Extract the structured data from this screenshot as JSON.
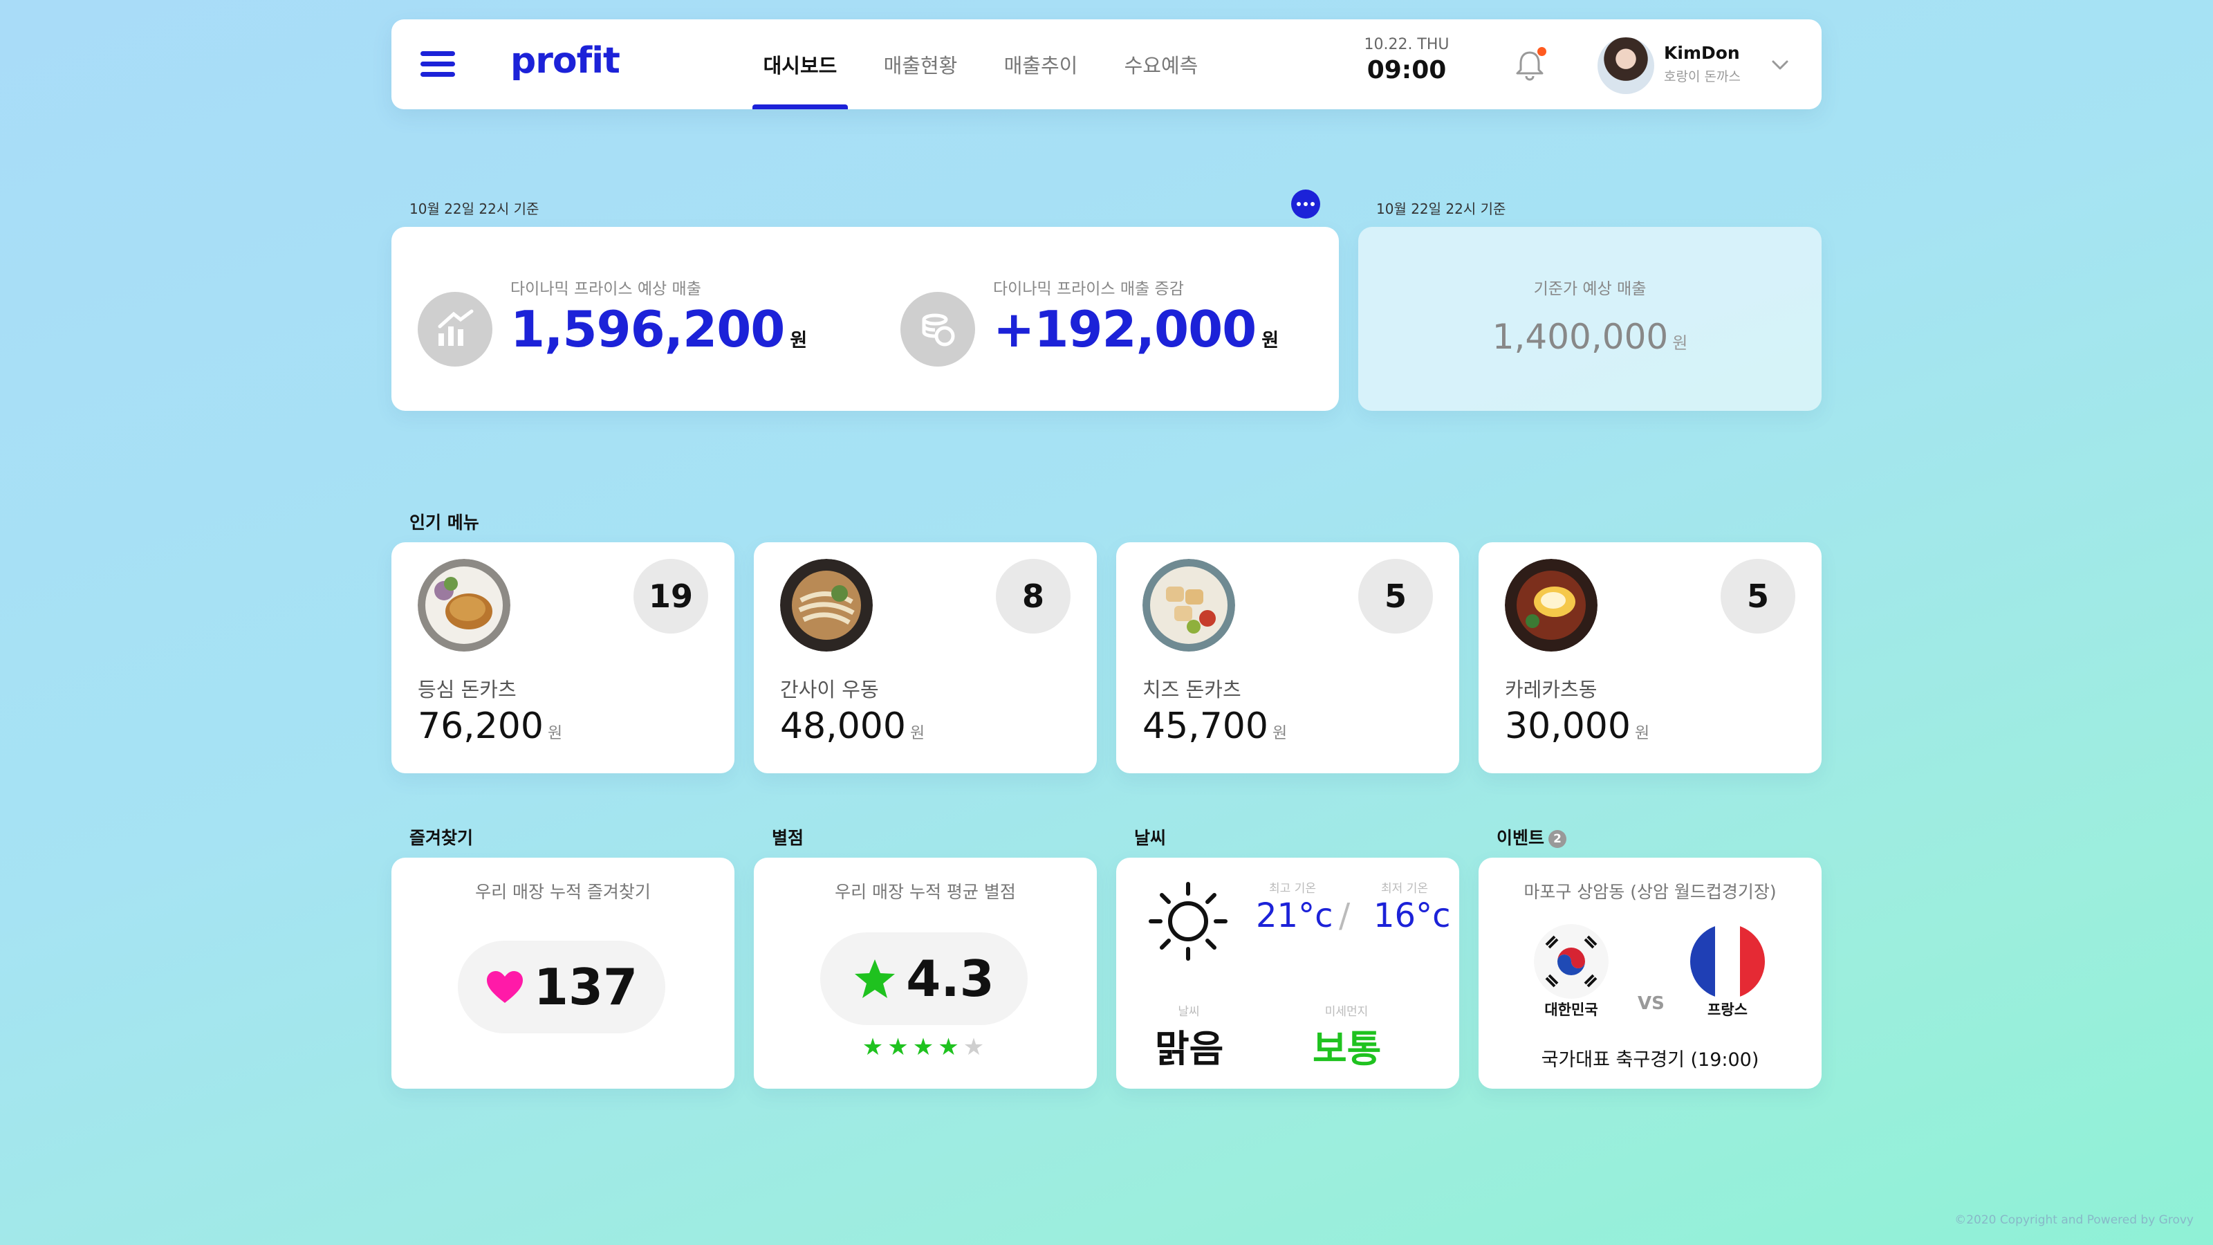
{
  "colors": {
    "accent": "#1c22d8",
    "heart": "#ff1aa8",
    "star": "#1fc21f",
    "good": "#1fc21f",
    "notify": "#ff5a1f"
  },
  "header": {
    "logo": "profit",
    "tabs": [
      {
        "label": "대시보드",
        "active": true
      },
      {
        "label": "매출현황",
        "active": false
      },
      {
        "label": "매출추이",
        "active": false
      },
      {
        "label": "수요예측",
        "active": false
      }
    ],
    "date": "10.22. THU",
    "time": "09:00",
    "user_name": "KimDon",
    "user_store": "호랑이 돈까스",
    "icons": {
      "menu": "hamburger-icon",
      "bell": "bell-icon",
      "dropdown": "chevron-down-icon"
    }
  },
  "sales": {
    "caption": "10월 22일 22시 기준",
    "dynamic_label": "다이나믹 프라이스 예상 매출",
    "dynamic_value": "1,596,200",
    "increase_label": "다이나믹 프라이스 매출 증감",
    "increase_value": "+192,000",
    "unit": "원"
  },
  "base": {
    "caption": "10월 22일 22시 기준",
    "label": "기준가 예상 매출",
    "value": "1,400,000",
    "unit": "원"
  },
  "popular": {
    "title": "인기 메뉴",
    "items": [
      {
        "name": "등심 돈카츠",
        "rank": "19",
        "price": "76,200",
        "unit": "원"
      },
      {
        "name": "간사이 우동",
        "rank": "8",
        "price": "48,000",
        "unit": "원"
      },
      {
        "name": "치즈 돈카츠",
        "rank": "5",
        "price": "45,700",
        "unit": "원"
      },
      {
        "name": "카레카츠동",
        "rank": "5",
        "price": "30,000",
        "unit": "원"
      }
    ]
  },
  "favorites": {
    "title": "즐겨찾기",
    "label": "우리 매장 누적 즐겨찾기",
    "count": "137"
  },
  "rating": {
    "title": "별점",
    "label": "우리 매장 누적 평균 별점",
    "score": "4.3",
    "stars_filled": 4,
    "stars_total": 5
  },
  "weather": {
    "title": "날씨",
    "high_label": "최고 기온",
    "high": "21°c",
    "low_label": "최저 기온",
    "low": "16°c",
    "cond_label": "날씨",
    "cond": "맑음",
    "dust_label": "미세먼지",
    "dust": "보통"
  },
  "event": {
    "title": "이벤트",
    "count": "2",
    "location": "마포구 상암동 (상암 월드컵경기장)",
    "team1": "대한민국",
    "vs": "VS",
    "team2": "프랑스",
    "desc": "국가대표 축구경기 (19:00)"
  },
  "footer": "©2020 Copyright and Powered by Grovy"
}
